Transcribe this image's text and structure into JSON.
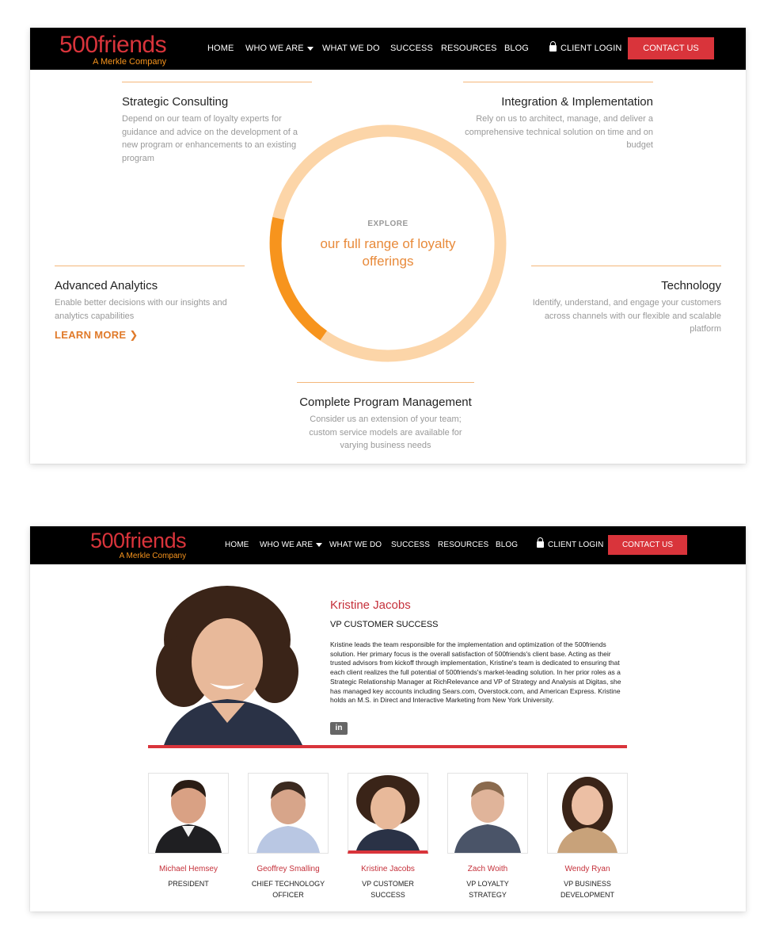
{
  "brand": {
    "name": "500friends",
    "tagline": "A Merkle Company",
    "primary_color": "#d9343b",
    "accent_color": "#f7941d"
  },
  "nav": {
    "items": [
      {
        "label": "HOME"
      },
      {
        "label": "WHO WE ARE"
      },
      {
        "label": "WHAT WE DO"
      },
      {
        "label": "SUCCESS"
      },
      {
        "label": "RESOURCES"
      },
      {
        "label": "BLOG"
      }
    ],
    "client_login": "CLIENT LOGIN",
    "contact": "CONTACT US"
  },
  "offerings": {
    "explore_label": "EXPLORE",
    "explore_text": "our full range of loyalty offerings",
    "highlighted_segment": "Advanced Analytics",
    "items": [
      {
        "title": "Strategic Consulting",
        "desc": "Depend on our team of loyalty experts for guidance and advice on the development of a new program or enhancements to an existing program"
      },
      {
        "title": "Integration & Implementation",
        "desc": "Rely on us to architect, manage, and deliver a comprehensive technical solution on time and on budget"
      },
      {
        "title": "Advanced Analytics",
        "desc": "Enable better decisions with our insights and analytics capabilities",
        "link": "LEARN MORE"
      },
      {
        "title": "Technology",
        "desc": "Identify, understand, and engage your customers across channels with our flexible and scalable platform"
      },
      {
        "title": "Complete Program Management",
        "desc": "Consider us an extension of your team; custom service models are available for varying business needs"
      }
    ]
  },
  "profile": {
    "name": "Kristine Jacobs",
    "title": "VP CUSTOMER SUCCESS",
    "bio": "Kristine leads the team responsible for the implementation and optimization of the 500friends solution. Her primary focus is the overall satisfaction of 500friends's client base. Acting as their trusted advisors from kickoff through implementation, Kristine's team is dedicated to ensuring that each client realizes the full potential of 500friends's market-leading solution. In her prior roles as a Strategic Relationship Manager at RichRelevance and VP of Strategy and Analysis at Digitas, she has managed key accounts including Sears.com, Overstock.com, and American Express. Kristine holds an M.S. in Direct and Interactive Marketing from New York University.",
    "social_icon": "linkedin-icon",
    "social_label": "in"
  },
  "team": [
    {
      "name": "Michael Hemsey",
      "role": "PRESIDENT"
    },
    {
      "name": "Geoffrey Smalling",
      "role": "CHIEF TECHNOLOGY OFFICER"
    },
    {
      "name": "Kristine Jacobs",
      "role": "VP CUSTOMER SUCCESS",
      "active": true
    },
    {
      "name": "Zach Woith",
      "role": "VP LOYALTY STRATEGY"
    },
    {
      "name": "Wendy Ryan",
      "role": "VP BUSINESS DEVELOPMENT"
    }
  ]
}
